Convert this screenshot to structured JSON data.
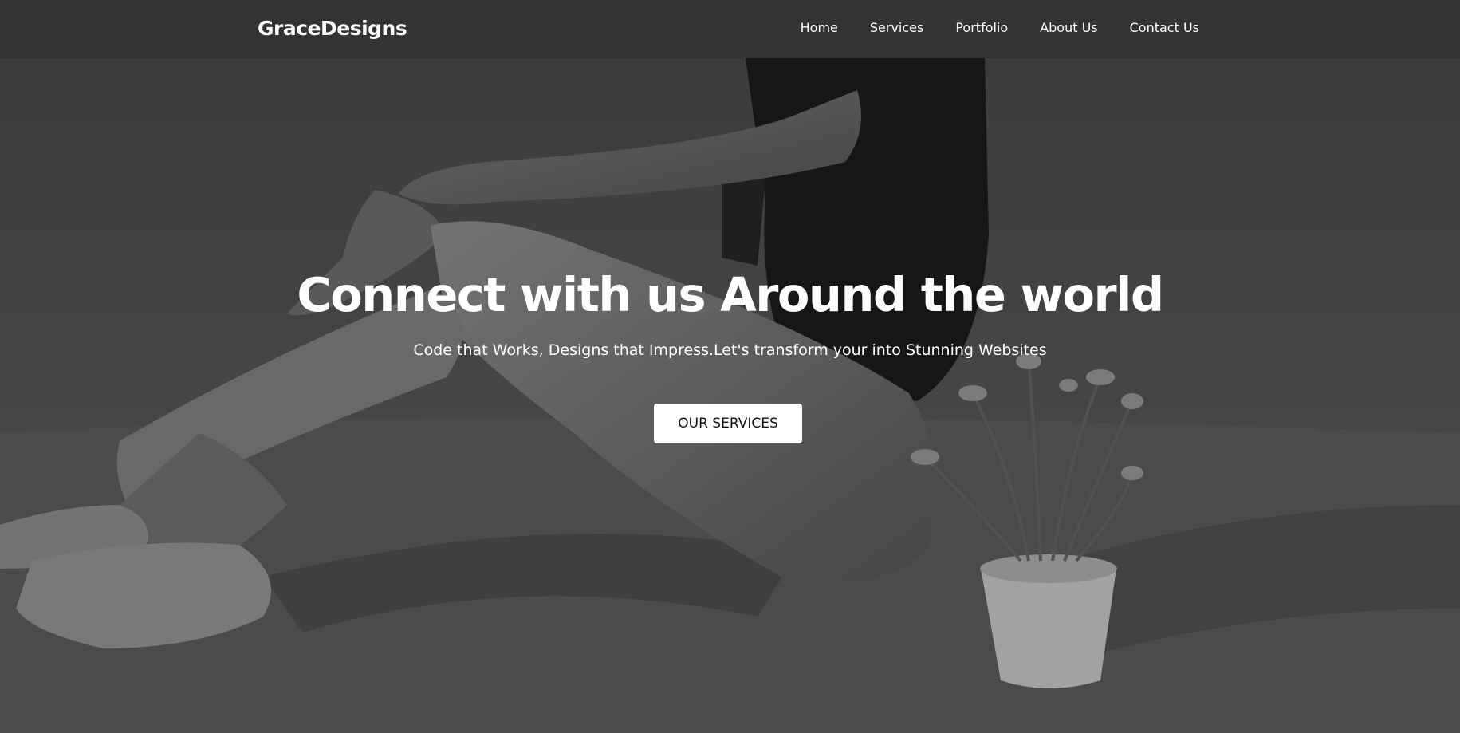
{
  "brand": {
    "name": "GraceDesigns"
  },
  "nav": {
    "items": [
      {
        "label": "Home"
      },
      {
        "label": "Services"
      },
      {
        "label": "Portfolio"
      },
      {
        "label": "About Us"
      },
      {
        "label": "Contact Us"
      }
    ]
  },
  "hero": {
    "title": "Connect with us Around the world",
    "subtitle": "Code that Works, Designs that Impress.Let's transform your into Stunning Websites",
    "cta_label": "OUR SERVICES"
  },
  "colors": {
    "navbar_bg": "#333333",
    "text": "#ffffff",
    "button_bg": "#ffffff",
    "button_text": "#111111"
  }
}
